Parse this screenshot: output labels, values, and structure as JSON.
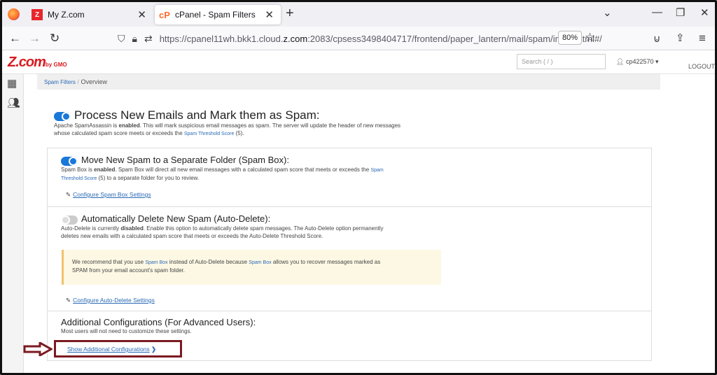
{
  "browser": {
    "tabs": [
      {
        "label": "My Z.com",
        "icon": "z-favicon"
      },
      {
        "label": "cPanel - Spam Filters",
        "icon": "cpanel-favicon"
      }
    ],
    "url_prefix": "https://cpanel11wh.bkk1.cloud.",
    "url_domain": "z.com",
    "url_suffix": ":2083/cpsess3498404717/frontend/paper_lantern/mail/spam/index.html#/",
    "zoom": "80%"
  },
  "header": {
    "logo": "Z.com",
    "logo_sub": "by GMO",
    "search_placeholder": "Search ( / )",
    "username": "cp422570",
    "logout": "LOGOUT"
  },
  "breadcrumb": {
    "link": "Spam Filters",
    "sep": "/",
    "current": "Overview"
  },
  "process": {
    "title": "Process New Emails and Mark them as Spam:",
    "desc_a": "Apache SpamAssassin is ",
    "desc_b": "enabled",
    "desc_c": ". This will mark suspicious email messages as spam. The server will update the header of new messages",
    "desc_d": "whose calculated spam score meets or exceeds the ",
    "desc_link": "Spam Threshold Score",
    "desc_e": " (5)."
  },
  "spambox": {
    "title": "Move New Spam to a Separate Folder (Spam Box):",
    "desc_a": "Spam Box is ",
    "desc_b": "enabled",
    "desc_c": ". Spam Box will direct all new email messages with a calculated spam score that meets or exceeds the ",
    "desc_link1": "Spam",
    "desc_link2": "Threshold Score",
    "desc_d": " (5) to a separate folder for you to review.",
    "config_link": "Configure Spam Box Settings"
  },
  "autodelete": {
    "title": "Automatically Delete New Spam (Auto-Delete):",
    "desc_a": "Auto-Delete is currently ",
    "desc_b": "disabled",
    "desc_c": ". Enable this option to automatically delete spam messages. The Auto-Delete option permanently",
    "desc_d": "deletes new emails with a calculated spam score that meets or exceeds the Auto-Delete Threshold Score.",
    "warn_a": "We recommend that you use ",
    "warn_link1": "Spam Box",
    "warn_b": " instead of Auto-Delete because ",
    "warn_link2": "Spam Box",
    "warn_c": " allows you to recover messages marked as",
    "warn_d": "SPAM from your email account's spam folder.",
    "config_link": "Configure Auto-Delete Settings"
  },
  "additional": {
    "title": "Additional Configurations (For Advanced Users):",
    "desc": "Most users will not need to customize these settings.",
    "show_link": "Show Additional Configurations"
  }
}
